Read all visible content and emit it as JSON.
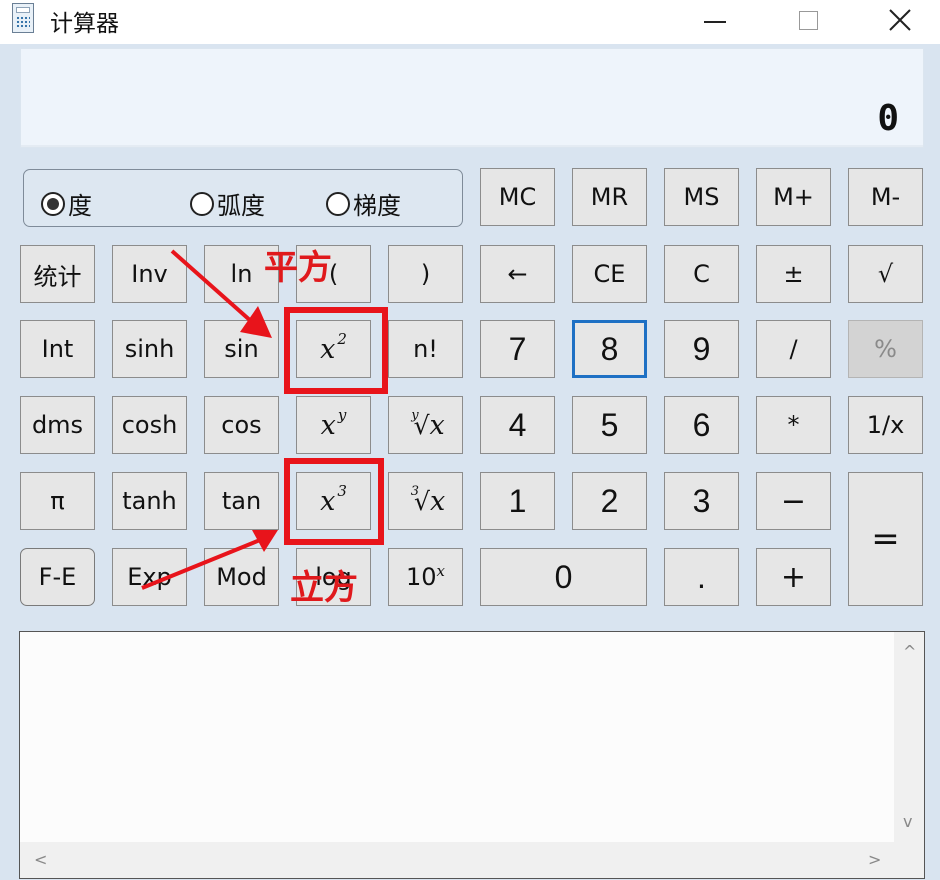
{
  "window": {
    "title": "计算器",
    "icons": {
      "app": "calculator-icon",
      "minimize": "minimize-icon",
      "maximize": "maximize-icon",
      "close": "close-icon"
    }
  },
  "display": {
    "value": "0"
  },
  "angle_mode": {
    "options": [
      {
        "label": "度",
        "checked": true
      },
      {
        "label": "弧度",
        "checked": false
      },
      {
        "label": "梯度",
        "checked": false
      }
    ]
  },
  "memory": {
    "mc": "MC",
    "mr": "MR",
    "ms": "MS",
    "mplus": "M+",
    "mminus": "M-"
  },
  "keys": {
    "stats": "统计",
    "inv": "Inv",
    "ln": "ln",
    "lparen": "(",
    "rparen": ")",
    "backspace": "←",
    "ce": "CE",
    "c": "C",
    "negate": "±",
    "sqrt": "√",
    "int": "Int",
    "sinh": "sinh",
    "sin": "sin",
    "square_base": "x",
    "square_exp": "2",
    "factorial": "n!",
    "seven": "7",
    "eight": "8",
    "nine": "9",
    "divide": "/",
    "percent": "%",
    "dms": "dms",
    "cosh": "cosh",
    "cos": "cos",
    "power_base": "x",
    "power_exp": "y",
    "yroot_index": "y",
    "yroot_sym": "√",
    "yroot_x": "x",
    "four": "4",
    "five": "5",
    "six": "6",
    "multiply": "*",
    "reciprocal": "1/x",
    "pi": "π",
    "tanh": "tanh",
    "tan": "tan",
    "cube_base": "x",
    "cube_exp": "3",
    "cuberoot_index": "3",
    "cuberoot_sym": "√",
    "cuberoot_x": "x",
    "one": "1",
    "two": "2",
    "three": "3",
    "subtract": "−",
    "fe": "F-E",
    "exp": "Exp",
    "mod": "Mod",
    "log": "log",
    "tenpow_base": "10",
    "tenpow_exp": "x",
    "zero": "0",
    "decimal": ".",
    "add": "+",
    "equals": "="
  },
  "history": {
    "scroll_up": "^",
    "scroll_down": "v",
    "scroll_left": "<",
    "scroll_right": ">"
  },
  "annotations": {
    "square_label": "平方",
    "cube_label": "立方",
    "color": "#e8141b"
  }
}
